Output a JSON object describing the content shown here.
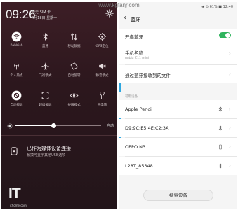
{
  "watermark": "www.kgfanr.com",
  "shade": {
    "time": "09:26",
    "carrier": "暂无 SIM 卡",
    "date": "4月18日 星期一",
    "icons": {
      "settings": "gear-icon"
    },
    "tiles": [
      {
        "label": "Rubbish",
        "icon": "wifi-icon"
      },
      {
        "label": "蓝牙",
        "icon": "bluetooth-icon"
      },
      {
        "label": "移动数据",
        "icon": "mobile-data-icon"
      },
      {
        "label": "GPS定位",
        "icon": "location-icon"
      },
      {
        "label": "个人热点",
        "icon": "hotspot-icon"
      },
      {
        "label": "飞行模式",
        "icon": "airplane-icon"
      },
      {
        "label": "自动旋转",
        "icon": "rotate-icon"
      },
      {
        "label": "静音模式",
        "icon": "mute-icon"
      },
      {
        "label": "自动锁屏",
        "icon": "lock-icon"
      },
      {
        "label": "超级截屏",
        "icon": "screenshot-icon"
      },
      {
        "label": "护眼模式",
        "icon": "eye-care-icon"
      },
      {
        "label": "手电筒",
        "icon": "flashlight-icon"
      }
    ],
    "brightness": {
      "level": 0.45,
      "auto_label": "自动"
    },
    "usb": {
      "title": "已作为媒体设备连接",
      "subtitle": "触摸可显示其他USB选项"
    },
    "logo": {
      "text": "IT",
      "site": "ithome.com"
    }
  },
  "phone": {
    "status": {
      "left": "...",
      "right": "◈ ⊙ 61% ■ 12:40"
    },
    "title": "蓝牙",
    "rows": {
      "bluetooth_toggle": {
        "label": "开启蓝牙",
        "on": true
      },
      "device_name": {
        "label": "手机名称",
        "value": "nubia Z11 mini"
      },
      "received_files": {
        "label": "通过蓝牙接收到的文件"
      }
    },
    "available_header": "可用设备",
    "devices": [
      {
        "name": "Apple Pencil",
        "icon": "bluetooth-icon"
      },
      {
        "name": "D9:9C:E5:4E:C2:3A",
        "icon": "bluetooth-icon"
      },
      {
        "name": "OPPO N3",
        "icon": "phone-icon"
      },
      {
        "name": "L28T_85348",
        "icon": "bluetooth-icon"
      }
    ],
    "scan_button": "搜索设备"
  },
  "colors": {
    "shade_bg": "#2c171d",
    "toggle_on": "#2fb35d",
    "accent": "#2da7e0"
  }
}
